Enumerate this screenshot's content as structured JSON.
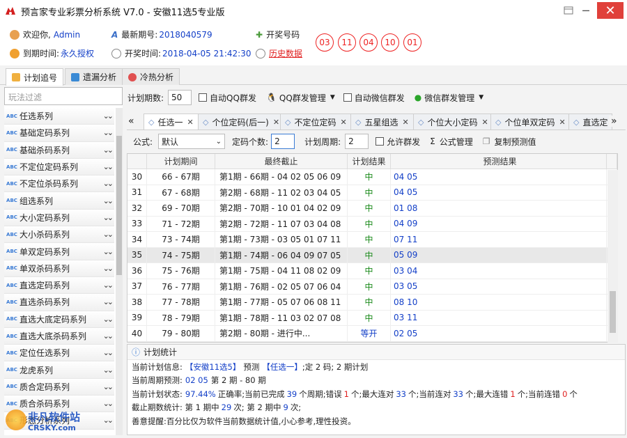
{
  "window": {
    "title": "预言家专业彩票分析系统 V7.0 - 安徽11选5专业版"
  },
  "info": {
    "welcome_label": "欢迎你,",
    "user": "Admin",
    "latest_label": "最新期号:",
    "latest_value": "2018040579",
    "draw_label": "开奖号码",
    "expire_label": "到期时间:",
    "expire_value": "永久授权",
    "open_time_label": "开奖时间:",
    "open_time_value": "2018-04-05 21:42:30",
    "history_label": "历史数据",
    "draw_numbers": [
      "03",
      "11",
      "04",
      "10",
      "01"
    ]
  },
  "main_tabs": [
    {
      "label": "计划追号",
      "active": true
    },
    {
      "label": "遗漏分析",
      "active": false
    },
    {
      "label": "冷热分析",
      "active": false
    }
  ],
  "sidebar": {
    "filter_placeholder": "玩法过滤",
    "items": [
      "任选系列",
      "基础定码系列",
      "基础杀码系列",
      "不定位定码系列",
      "不定位杀码系列",
      "组选系列",
      "大小定码系列",
      "大小杀码系列",
      "单双定码系列",
      "单双杀码系列",
      "直选定码系列",
      "直选杀码系列",
      "直选大底定码系列",
      "直选大底杀码系列",
      "定位任选系列",
      "龙虎系列",
      "质合定码系列",
      "质合杀码系列",
      "形态分析系列"
    ]
  },
  "toolbar": {
    "plan_count_label": "计划期数:",
    "plan_count_value": "50",
    "auto_qq": "自动QQ群发",
    "qq_manage": "QQ群发管理",
    "auto_wechat": "自动微信群发",
    "wechat_manage": "微信群发管理"
  },
  "plan_tabs": [
    "任选一",
    "个位定码(后一)",
    "不定位定码",
    "五星组选",
    "个位大小定码",
    "个位单双定码",
    "直选定"
  ],
  "formula_bar": {
    "formula_label": "公式:",
    "formula_value": "默认",
    "count_label": "定码个数:",
    "count_value": "2",
    "period_label": "计划周期:",
    "period_value": "2",
    "allow_group": "允许群发",
    "formula_manage": "公式管理",
    "copy_predict": "复制预测值"
  },
  "grid": {
    "columns": [
      "计划期间",
      "最终截止",
      "计划结果",
      "预测结果"
    ],
    "rows": [
      {
        "no": "30",
        "period": "66 - 67期",
        "end": "第1期 - 66期 - 04 02 05 06 09",
        "result": "中",
        "predict": "04 05"
      },
      {
        "no": "31",
        "period": "67 - 68期",
        "end": "第2期 - 68期 - 11 02 03 04 05",
        "result": "中",
        "predict": "04 05"
      },
      {
        "no": "32",
        "period": "69 - 70期",
        "end": "第2期 - 70期 - 10 01 04 02 09",
        "result": "中",
        "predict": "01 08"
      },
      {
        "no": "33",
        "period": "71 - 72期",
        "end": "第2期 - 72期 - 11 07 03 04 08",
        "result": "中",
        "predict": "04 09"
      },
      {
        "no": "34",
        "period": "73 - 74期",
        "end": "第1期 - 73期 - 03 05 01 07 11",
        "result": "中",
        "predict": "07 11"
      },
      {
        "no": "35",
        "period": "74 - 75期",
        "end": "第1期 - 74期 - 06 04 09 07 05",
        "result": "中",
        "predict": "05 09"
      },
      {
        "no": "36",
        "period": "75 - 76期",
        "end": "第1期 - 75期 - 04 11 08 02 09",
        "result": "中",
        "predict": "03 04"
      },
      {
        "no": "37",
        "period": "76 - 77期",
        "end": "第1期 - 76期 - 02 05 07 06 04",
        "result": "中",
        "predict": "03 05"
      },
      {
        "no": "38",
        "period": "77 - 78期",
        "end": "第1期 - 77期 - 05 07 06 08 11",
        "result": "中",
        "predict": "08 10"
      },
      {
        "no": "39",
        "period": "78 - 79期",
        "end": "第1期 - 78期 - 11 03 02 07 08",
        "result": "中",
        "predict": "03 11"
      },
      {
        "no": "40",
        "period": "79 - 80期",
        "end": "第2期 - 80期 - 进行中...",
        "result": "等开",
        "predict": "02 05"
      }
    ],
    "selected_row": 5
  },
  "stats": {
    "title": "计划统计",
    "l1_a": "当前计划信息:",
    "l1_b": "【安徽11选5】",
    "l1_c": "预测",
    "l1_d": "【任选一】",
    "l1_e": ";定 2 码; 2 期计划",
    "l2_a": "当前周期预测:",
    "l2_b": "02 05",
    "l2_c": "第 2 期 - 80 期",
    "l3_a": "当前计划状态:",
    "l3_rate": "97.44%",
    "l3_b": "正确率;当前已完成",
    "l3_done": "39",
    "l3_c": "个周期;错误",
    "l3_err": "1",
    "l3_d": "个;最大连对",
    "l3_maxok": "33",
    "l3_e": "个;当前连对",
    "l3_curok": "33",
    "l3_f": "个;最大连错",
    "l3_maxerr": "1",
    "l3_g": "个;当前连错",
    "l3_curerr": "0",
    "l3_h": "个",
    "l4_a": "截止期数统计: 第 1 期中",
    "l4_n1": "29",
    "l4_b": "次; 第 2 期中",
    "l4_n2": "9",
    "l4_c": "次;",
    "l5": "善意提醒:百分比仅为软件当前数据统计值,小心参考,理性投资。"
  },
  "watermark": {
    "cn": "非凡软件站",
    "en": "CRSKY.com"
  }
}
